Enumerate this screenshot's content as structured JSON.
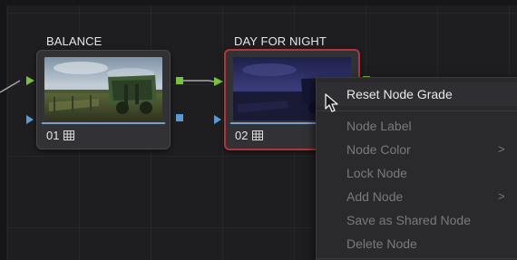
{
  "nodes": [
    {
      "label": "BALANCE",
      "number": "01"
    },
    {
      "label": "DAY FOR NIGHT",
      "number": "02"
    }
  ],
  "context_menu": {
    "items": [
      {
        "label": "Reset Node Grade",
        "enabled": true
      },
      {
        "label": "Node Label",
        "enabled": false
      },
      {
        "label": "Node Color",
        "enabled": false,
        "submenu": true
      },
      {
        "label": "Lock Node",
        "enabled": false
      },
      {
        "label": "Add Node",
        "enabled": false,
        "submenu": true
      },
      {
        "label": "Save as Shared Node",
        "enabled": false
      },
      {
        "label": "Delete Node",
        "enabled": false
      }
    ],
    "submenu_arrow": ">"
  },
  "colors": {
    "canvas_bg": "#1e1e20",
    "node_bg": "#323236",
    "selected_border": "#b3343a",
    "rgb_link": "#7ac142",
    "alpha_link": "#5b9bd5",
    "menu_bg": "#2a2a2d",
    "menu_text_enabled": "#e8e8e8",
    "menu_text_disabled": "#7a7a7e"
  },
  "icons": {
    "node_type": "grid-table-icon",
    "rgb_input": "green-triangle-port-icon",
    "rgb_output": "green-square-port-icon",
    "alpha_input": "blue-triangle-port-icon",
    "alpha_output": "blue-square-port-icon",
    "pointer": "mouse-pointer-icon"
  }
}
